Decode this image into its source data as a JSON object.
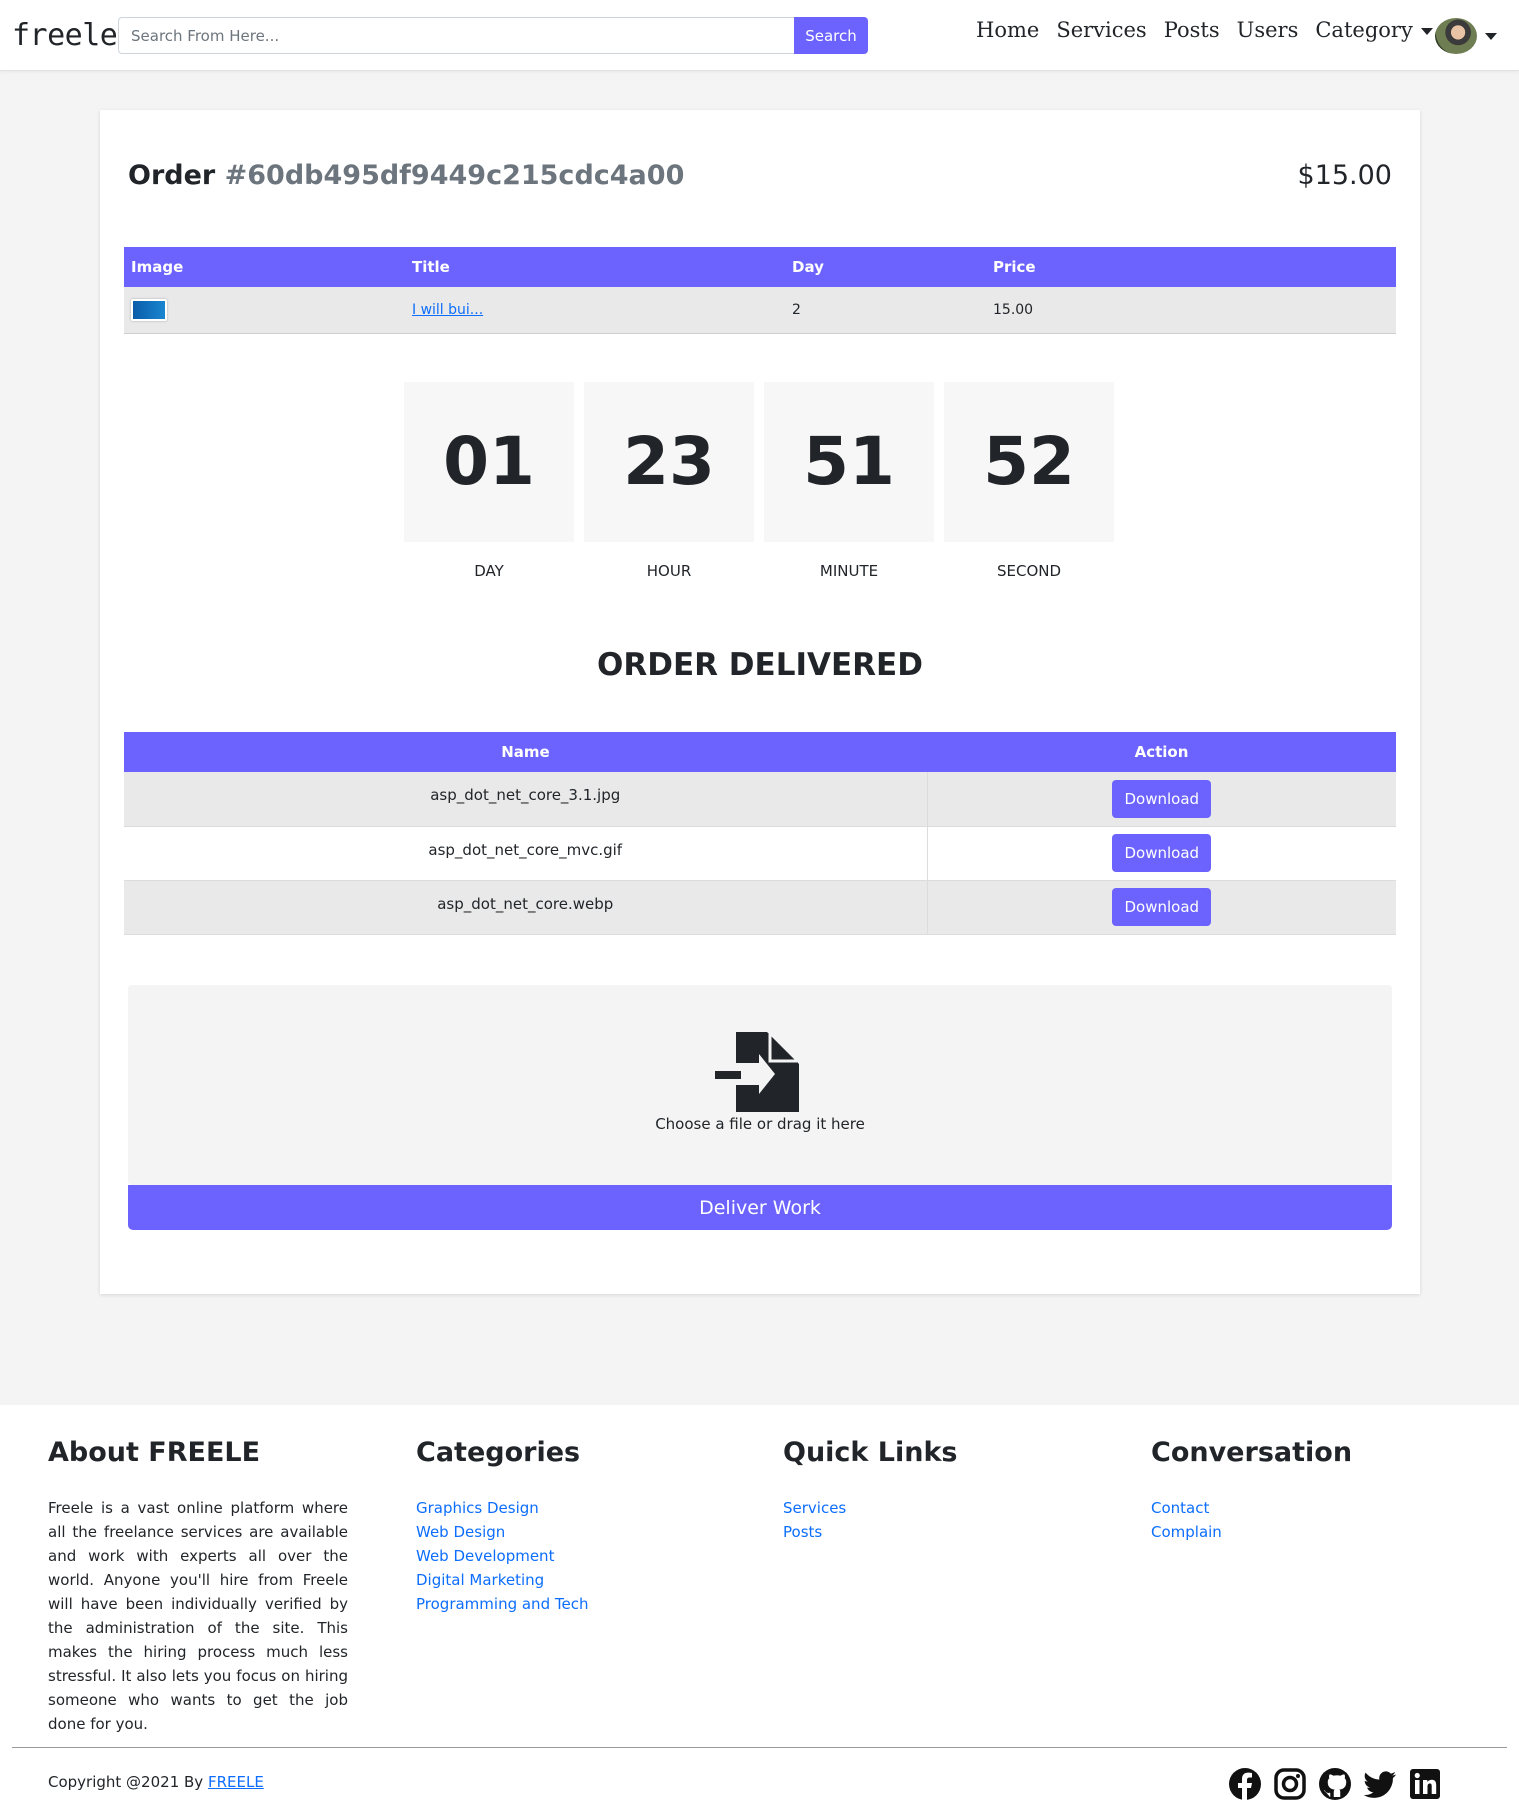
{
  "nav": {
    "brand": "freele",
    "search_placeholder": "Search From Here...",
    "search_label": "Search",
    "links": [
      "Home",
      "Services",
      "Posts",
      "Users",
      "Category"
    ]
  },
  "order": {
    "label": "Order",
    "id": "#60db495df9449c215cdc4a00",
    "total": "$15.00",
    "table_headers": [
      "Image",
      "Title",
      "Day",
      "Price"
    ],
    "item": {
      "title": "I will bui...",
      "day": "2",
      "price": "15.00"
    }
  },
  "countdown": [
    {
      "value": "01",
      "label": "DAY"
    },
    {
      "value": "23",
      "label": "HOUR"
    },
    {
      "value": "51",
      "label": "MINUTE"
    },
    {
      "value": "52",
      "label": "SECOND"
    }
  ],
  "delivery": {
    "status": "ORDER DELIVERED",
    "headers": [
      "Name",
      "Action"
    ],
    "files": [
      {
        "name": "asp_dot_net_core_3.1.jpg",
        "action": "Download"
      },
      {
        "name": "asp_dot_net_core_mvc.gif",
        "action": "Download"
      },
      {
        "name": "asp_dot_net_core.webp",
        "action": "Download"
      }
    ],
    "dropzone_text": "Choose a file or drag it here",
    "deliver_label": "Deliver Work"
  },
  "footer": {
    "about_title": "About FREELE",
    "about_text": "Freele is a vast online platform where all the freelance services are available and work with experts all over the world. Anyone you'll hire from Freele will have been individually verified by the administration of the site. This makes the hiring process much less stressful. It also lets you focus on hiring someone who wants to get the job done for you.",
    "categories_title": "Categories",
    "categories": [
      "Graphics Design",
      "Web Design",
      "Web Development",
      "Digital Marketing",
      "Programming and Tech"
    ],
    "quick_title": "Quick Links",
    "quick_links": [
      "Services",
      "Posts"
    ],
    "conv_title": "Conversation",
    "conv_links": [
      "Contact",
      "Complain"
    ],
    "copyright_prefix": "Copyright @2021 By",
    "copyright_link": "FREELE",
    "social_icons": [
      "facebook-icon",
      "instagram-icon",
      "github-icon",
      "twitter-icon",
      "linkedin-icon"
    ]
  },
  "colors": {
    "accent": "#6c63ff",
    "link": "#0d6efd",
    "page_bg": "#f4f4f4"
  }
}
